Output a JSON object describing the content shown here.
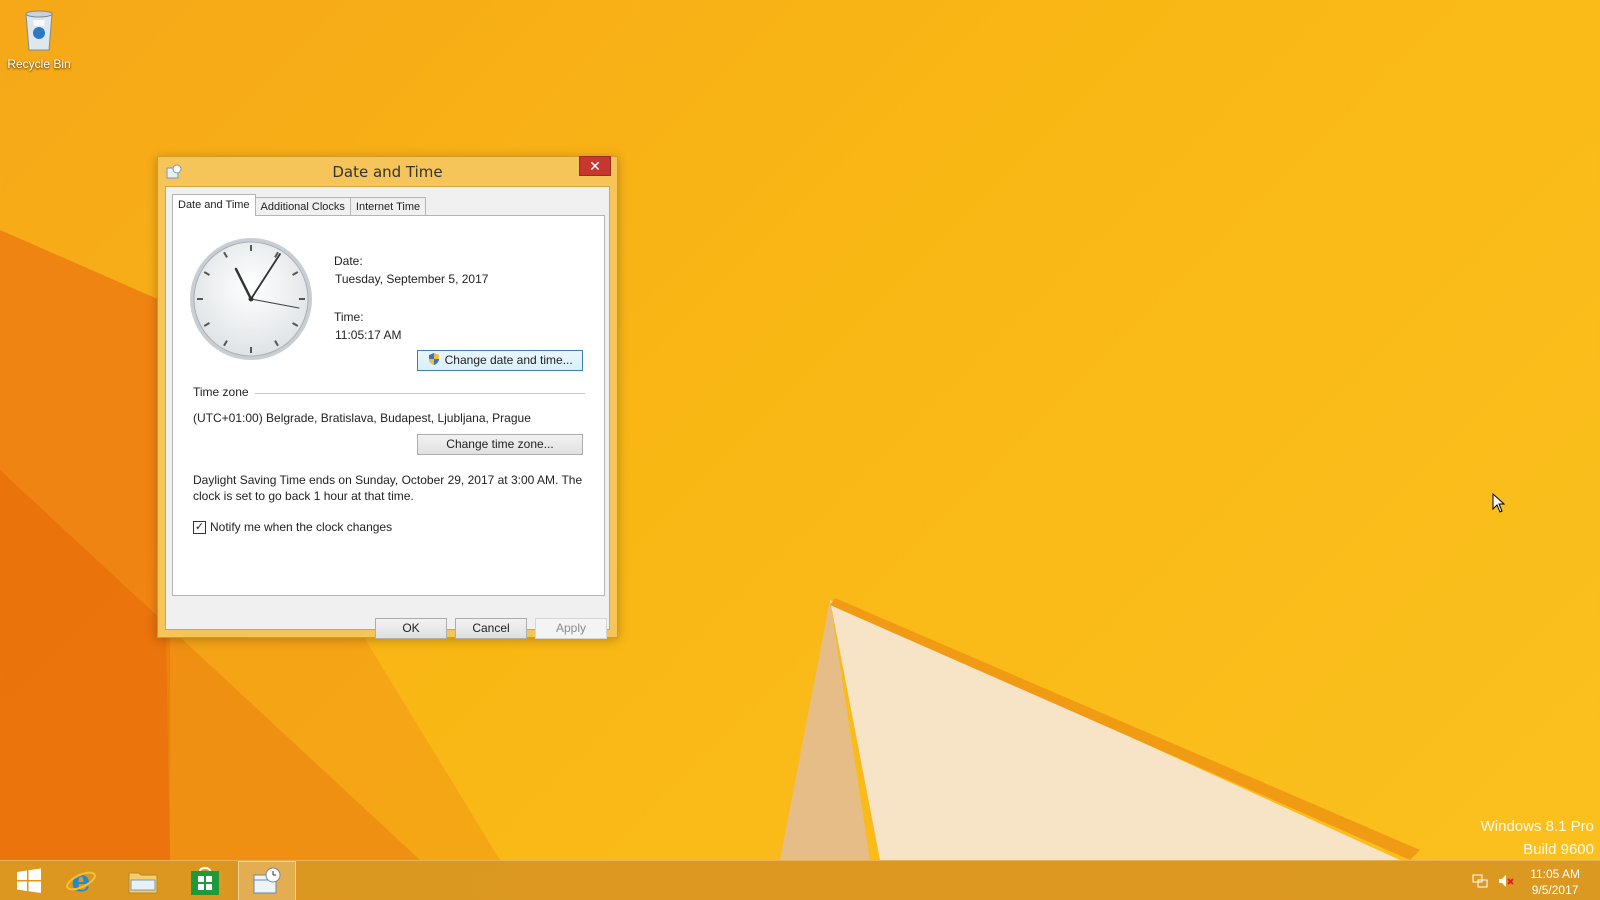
{
  "desktop": {
    "recycle_bin_label": "Recycle Bin",
    "watermark_line1": "Windows 8.1 Pro",
    "watermark_line2": "Build 9600"
  },
  "window": {
    "title": "Date and Time",
    "close_label": "✕",
    "tabs": [
      {
        "label": "Date and Time",
        "active": true
      },
      {
        "label": "Additional Clocks",
        "active": false
      },
      {
        "label": "Internet Time",
        "active": false
      }
    ],
    "date_label": "Date:",
    "date_value": "Tuesday, September 5, 2017",
    "time_label": "Time:",
    "time_value": "11:05:17 AM",
    "change_datetime_button": "Change date and time...",
    "timezone_header": "Time zone",
    "timezone_value": "(UTC+01:00) Belgrade, Bratislava, Budapest, Ljubljana, Prague",
    "change_timezone_button": "Change time zone...",
    "dst_line1": "Daylight Saving Time ends on Sunday, October 29, 2017 at 3:00 AM. The",
    "dst_line2": "clock is set to go back 1 hour at that time.",
    "notify_checkbox_label": "Notify me when the clock changes",
    "notify_checked": true,
    "ok_button": "OK",
    "cancel_button": "Cancel",
    "apply_button": "Apply"
  },
  "taskbar": {
    "items": [
      "start-button",
      "internet-explorer",
      "file-explorer",
      "store",
      "date-and-time"
    ],
    "active_item": "date-and-time",
    "clock_time": "11:05 AM",
    "clock_date": "9/5/2017"
  },
  "colors": {
    "window_frame": "#f6c55a",
    "close_button": "#c7372f",
    "taskbar": "#d69222"
  }
}
